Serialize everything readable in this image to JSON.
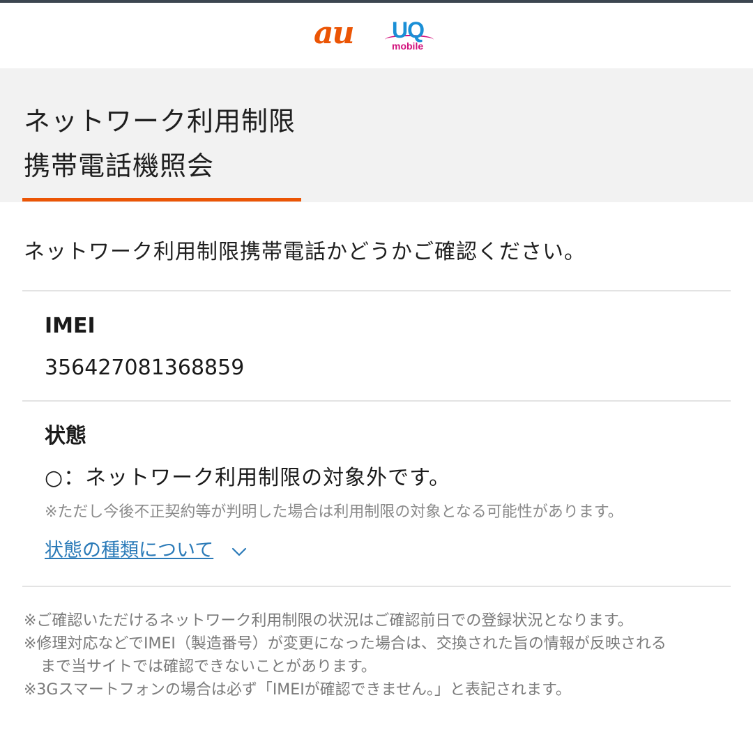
{
  "header": {
    "logo_au": "au",
    "logo_uq": "UQ",
    "logo_uq_sub": "mobile"
  },
  "page": {
    "title_line1": "ネットワーク利用制限",
    "title_line2": "携帯電話機照会",
    "intro": "ネットワーク利用制限携帯電話かどうかご確認ください。"
  },
  "imei": {
    "label": "IMEI",
    "value": "356427081368859"
  },
  "status": {
    "label": "状態",
    "value": "○：ネットワーク利用制限の対象外です。",
    "note": "※ただし今後不正契約等が判明した場合は利用制限の対象となる可能性があります。",
    "link_label": "状態の種類について"
  },
  "footer_notes": {
    "line1": "※ご確認いただけるネットワーク利用制限の状況はご確認前日での登録状況となります。",
    "line2": "※修理対応などでIMEI（製造番号）が変更になった場合は、交換された旨の情報が反映される",
    "line2_cont": "まで当サイトでは確認できないことがあります。",
    "line3": "※3Gスマートフォンの場合は必ず「IMEIが確認できません。」と表記されます。"
  },
  "colors": {
    "au_orange": "#eb5505",
    "uq_blue": "#1a8fd6",
    "uq_magenta": "#d10f7b",
    "link_blue": "#2a7ab8",
    "hero_bg": "#f2f2f2"
  },
  "icons": {
    "expand": "chevron-down-icon"
  }
}
